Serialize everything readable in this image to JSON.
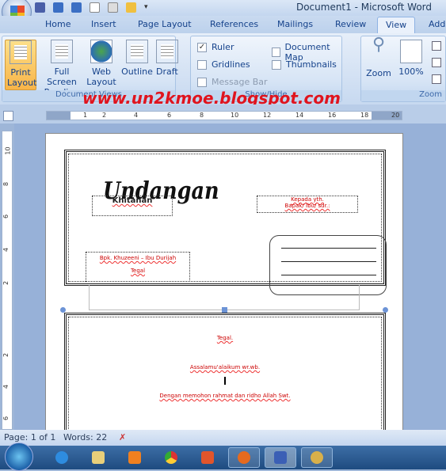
{
  "window": {
    "title": "Document1 - Microsoft Word"
  },
  "tabs": [
    "Home",
    "Insert",
    "Page Layout",
    "References",
    "Mailings",
    "Review",
    "View",
    "Add"
  ],
  "active_tab": "View",
  "ribbon": {
    "document_views": {
      "label": "Document Views",
      "buttons": [
        "Print Layout",
        "Full Screen Reading",
        "Web Layout",
        "Outline",
        "Draft"
      ],
      "selected": "Print Layout"
    },
    "show_hide": {
      "label": "Show/Hide",
      "checkboxes": [
        {
          "label": "Ruler",
          "checked": true
        },
        {
          "label": "Gridlines",
          "checked": false
        },
        {
          "label": "Message Bar",
          "checked": false,
          "disabled": true
        },
        {
          "label": "Document Map",
          "checked": false
        },
        {
          "label": "Thumbnails",
          "checked": false
        }
      ]
    },
    "zoom": {
      "label": "Zoom",
      "buttons": [
        "Zoom",
        "100%"
      ]
    }
  },
  "watermark": "www.un2kmoe.blogspot.com",
  "ruler": {
    "ticks": [
      "1",
      "2",
      "4",
      "6",
      "8",
      "10",
      "12",
      "14",
      "16",
      "18",
      "20"
    ],
    "vticks": [
      "10",
      "8",
      "6",
      "4",
      "2",
      "2",
      "4",
      "6"
    ]
  },
  "document": {
    "title": "Undangan",
    "subtitle": "Khitanan",
    "to_line1": "Kepada yth.",
    "to_line2": "Bapak/ Ibu/ sdr.:",
    "from": "Bpk. Khuzeeni – Ibu Durijah",
    "from_place": "Tegal",
    "body_place": "Tegal.",
    "greeting": "Assalamu'alaikum wr.wb.",
    "body": "Dengan memohon rahmat dan ridho Allah Swt."
  },
  "status": {
    "page": "Page: 1 of 1",
    "words": "Words: 22"
  },
  "taskbar": [
    "internet-explorer",
    "file-explorer",
    "media-player",
    "chrome",
    "powerpoint",
    "firefox",
    "word",
    "paint"
  ]
}
